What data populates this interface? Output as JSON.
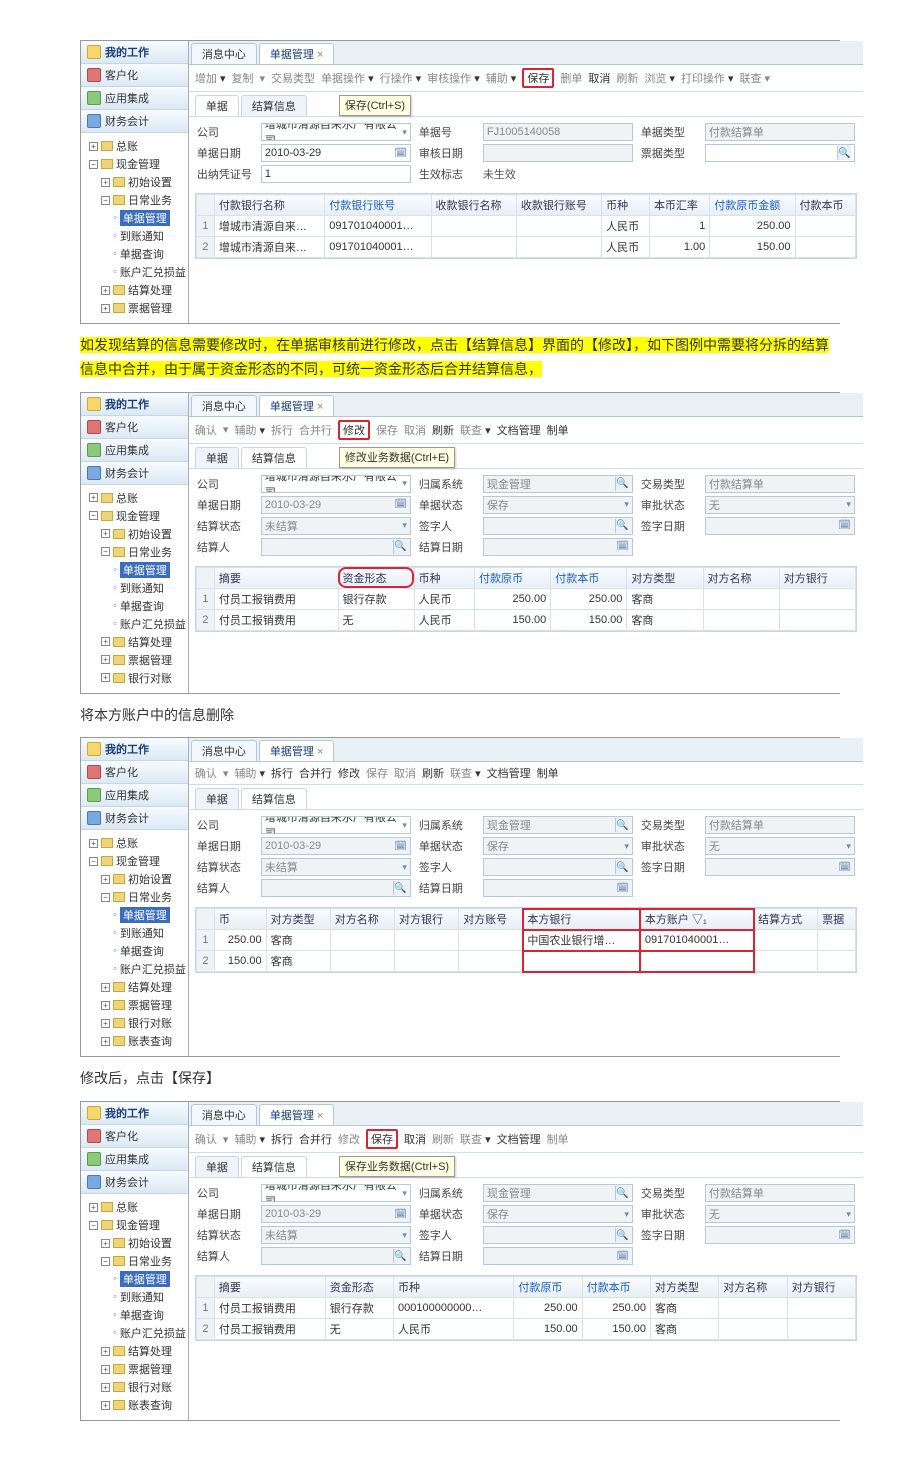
{
  "doc": {
    "para1_hl": "如发现结算的信息需要修改时，在单据审核前进行修改，点击【结算信息】界面的【修改】，如下图例中需要将分拆的结算信息中合并，由于属于资金形态的不同，可统一资金形态后合并结算信息，",
    "para2": "将本方账户中的信息删除",
    "para3": "修改后，点击【保存】"
  },
  "sidebar": {
    "sec_mywork": "我的工作",
    "sec_kehuhua": "客户化",
    "sec_yingyong": "应用集成",
    "sec_caiwu": "财务会计",
    "nodes": {
      "zongzhang": "总账",
      "xjgl": "现金管理",
      "chushi": "初始设置",
      "ricang": "日常业务",
      "djgl": "单据管理",
      "daozhang": "到账通知",
      "djcx": "单据查询",
      "zhsy": "账户汇兑损益",
      "jiesuan": "结算处理",
      "piaoju": "票据管理",
      "yhdz": "银行对账",
      "zhcx": "账表查询"
    }
  },
  "tabs": {
    "msg": "消息中心",
    "bill": "单据管理"
  },
  "tooltips": {
    "save": "保存(Ctrl+S)",
    "modify": "修改业务数据(Ctrl+E)",
    "save2": "保存业务数据(Ctrl+S)"
  },
  "shot1": {
    "toolbar": {
      "t1": "增加",
      "t2": "复制",
      "t3": "交易类型",
      "t4": "单据操作",
      "t5": "行操作",
      "t6": "审核操作",
      "t7": "辅助",
      "t8": "保存",
      "t9": "删单",
      "t10": "取消",
      "t11": "刷新",
      "t12": "浏览",
      "t13": "打印操作",
      "t14": "联查"
    },
    "subtabs": {
      "a": "单据",
      "b": "结算信息"
    },
    "form": {
      "gongsi": "公司",
      "gongsi_v": "增城市清源自来水厂有限公司",
      "danjuhao": "单据号",
      "danjuhao_v": "FJ1005140058",
      "djlx": "单据类型",
      "djlx_v": "付款结算单",
      "djrq": "单据日期",
      "djrq_v": "2010-03-29",
      "shrq": "审核日期",
      "shrq_v": "",
      "pjlx": "票据类型",
      "pjlx_v": "",
      "cnpzh": "出纳凭证号",
      "cnpzh_v": "1",
      "sxbz": "生效标志",
      "sxbz_v": "未生效"
    },
    "cols": {
      "c1": "付款银行名称",
      "c2": "付款银行账号",
      "c3": "收款银行名称",
      "c4": "收款银行账号",
      "c5": "币种",
      "c6": "本币汇率",
      "c7": "付款原币金额",
      "c8": "付款本币"
    },
    "rows": [
      {
        "r": "1",
        "n": "增城市清源自来…",
        "a": "091701040001…",
        "b": "人民币",
        "rate": "1",
        "amt": "250.00"
      },
      {
        "r": "2",
        "n": "增城市清源自来…",
        "a": "091701040001…",
        "b": "人民币",
        "rate": "1.00",
        "amt": "150.00"
      }
    ]
  },
  "shot2": {
    "toolbar": {
      "t1": "确认",
      "t2": "辅助",
      "t3": "拆行",
      "t4": "合并行",
      "t5": "修改",
      "t6": "保存",
      "t7": "取消",
      "t8": "刷新",
      "t9": "联查",
      "t10": "文档管理",
      "t11": "制单"
    },
    "form": {
      "gongsi": "公司",
      "gongsi_v": "增城市清源自来水厂有限公司",
      "gsxt": "归属系统",
      "gsxt_v": "现金管理",
      "jylx": "交易类型",
      "jylx_v": "付款结算单",
      "djrq": "单据日期",
      "djrq_v": "2010-03-29",
      "djzt": "单据状态",
      "djzt_v": "保存",
      "spzt": "审批状态",
      "spzt_v": "无",
      "jszt": "结算状态",
      "jszt_v": "未结算",
      "qzr": "签字人",
      "qzrq": "签字日期",
      "jsr": "结算人",
      "jsrq": "结算日期"
    },
    "cols": {
      "c1": "摘要",
      "c2": "资金形态",
      "c3": "币种",
      "c4": "付款原币",
      "c5": "付款本币",
      "c6": "对方类型",
      "c7": "对方名称",
      "c8": "对方银行"
    },
    "rows": [
      {
        "r": "1",
        "zy": "付员工报销费用",
        "zj": "银行存款",
        "bz": "人民币",
        "yb": "250.00",
        "bb": "250.00",
        "dl": "客商"
      },
      {
        "r": "2",
        "zy": "付员工报销费用",
        "zj": "无",
        "bz": "人民币",
        "yb": "150.00",
        "bb": "150.00",
        "dl": "客商"
      }
    ]
  },
  "shot3": {
    "toolbar": {
      "t1": "确认",
      "t2": "辅助",
      "t3": "拆行",
      "t4": "合并行",
      "t5": "修改",
      "t6": "保存",
      "t7": "取消",
      "t8": "刷新",
      "t9": "联查",
      "t10": "文档管理",
      "t11": "制单"
    },
    "cols": {
      "c0": "币",
      "c1": "对方类型",
      "c2": "对方名称",
      "c3": "对方银行",
      "c4": "对方账号",
      "c5": "本方银行",
      "c6": "本方账户 ▽₁",
      "c7": "结算方式",
      "c8": "票据"
    },
    "rows": [
      {
        "r": "1",
        "bi": "250.00",
        "dl": "客商",
        "yh": "中国农业银行增…",
        "zh": "091701040001…"
      },
      {
        "r": "2",
        "bi": "150.00",
        "dl": "客商",
        "yh": "",
        "zh": ""
      }
    ]
  },
  "shot4": {
    "toolbar": {
      "t1": "确认",
      "t2": "辅助",
      "t3": "拆行",
      "t4": "合并行",
      "t5": "修改",
      "t6": "保存",
      "t7": "取消",
      "t8": "刷新",
      "t9": "联查",
      "t10": "文档管理",
      "t11": "制单"
    },
    "cols": {
      "c1": "摘要",
      "c2": "资金形态",
      "c3": "币种",
      "c4": "付款原币",
      "c5": "付款本币",
      "c6": "对方类型",
      "c7": "对方名称",
      "c8": "对方银行"
    },
    "rows": [
      {
        "r": "1",
        "zy": "付员工报销费用",
        "zj": "银行存款",
        "bz": "000100000000…",
        "yb": "250.00",
        "bb": "250.00",
        "dl": "客商"
      },
      {
        "r": "2",
        "zy": "付员工报销费用",
        "zj": "无",
        "bz": "人民币",
        "yb": "150.00",
        "bb": "150.00",
        "dl": "客商"
      }
    ]
  }
}
